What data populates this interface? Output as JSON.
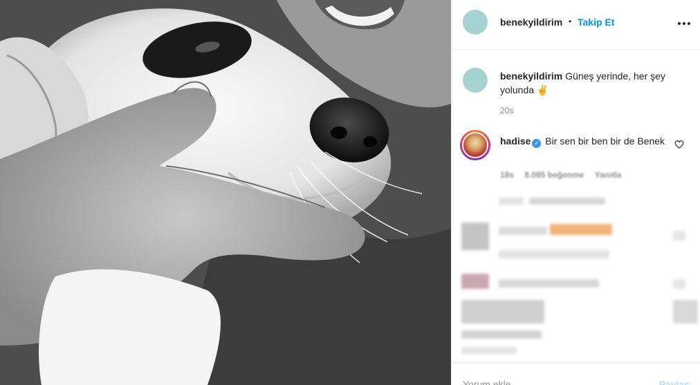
{
  "header": {
    "username": "benekyildirim",
    "separator": "•",
    "follow_label": "Takip Et"
  },
  "caption": {
    "username": "benekyildirim",
    "text": "Güneş yerinde, her şey yolunda ✌️",
    "time": "20s"
  },
  "comment": {
    "username": "hadise",
    "verified_glyph": "✓",
    "text": "Bir sen bir ben bir de Benek",
    "time": "18s",
    "likes": "8.085 beğenme",
    "reply_label": "Yanıtla"
  },
  "input": {
    "placeholder": "Yorum ekle...",
    "share_label": "Paylaş"
  },
  "icons": {
    "more": "more-horizontal-icon",
    "like": "heart-outline-icon",
    "verified": "verified-badge-icon"
  },
  "colors": {
    "accent": "#0095f6",
    "avatar": "#a7d2d2",
    "muted": "#8e8e8e",
    "share_disabled": "#b2dffc"
  }
}
